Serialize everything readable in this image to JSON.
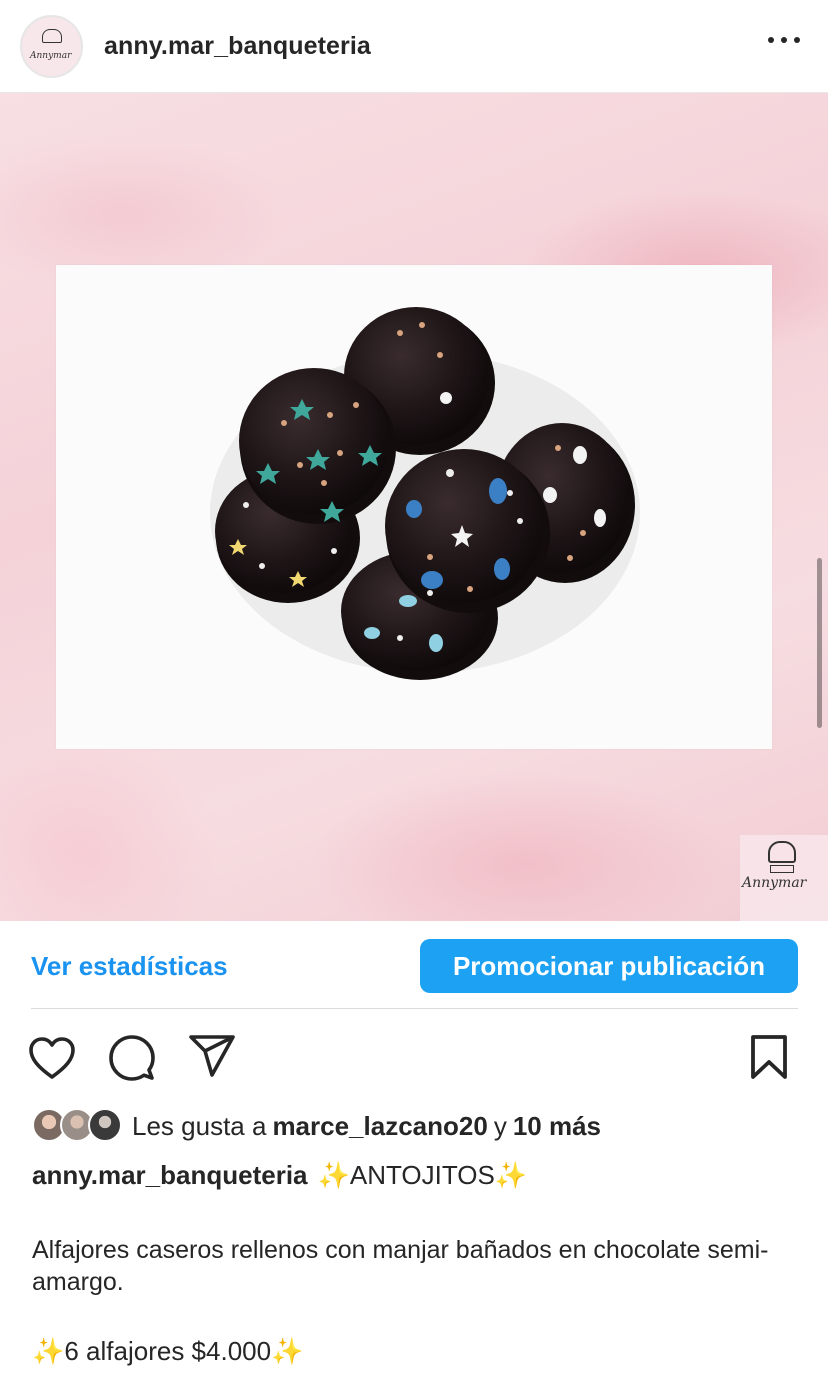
{
  "header": {
    "username": "anny.mar_banqueteria",
    "avatar_icon": "chef-hat-logo-icon",
    "more_icon": "more-options-icon"
  },
  "post": {
    "image_alt": "Alfajores bañados en chocolate sobre papel blanco",
    "watermark_text": "Annymar"
  },
  "actions": {
    "stats_label": "Ver estadísticas",
    "promote_label": "Promocionar publicación",
    "like_icon": "heart-icon",
    "comment_icon": "comment-icon",
    "share_icon": "share-icon",
    "save_icon": "bookmark-icon",
    "accent_color": "#1da1f2"
  },
  "likes": {
    "prefix": "Les gusta a",
    "user": "marce_lazcano20",
    "conj": "y",
    "others": "10 más"
  },
  "caption": {
    "username": "anny.mar_banqueteria",
    "sparkle": "✨",
    "title": "ANTOJITOS",
    "body": "Alfajores caseros rellenos con manjar bañados en chocolate semi-amargo.",
    "price_line": "6 alfajores $4.000"
  }
}
